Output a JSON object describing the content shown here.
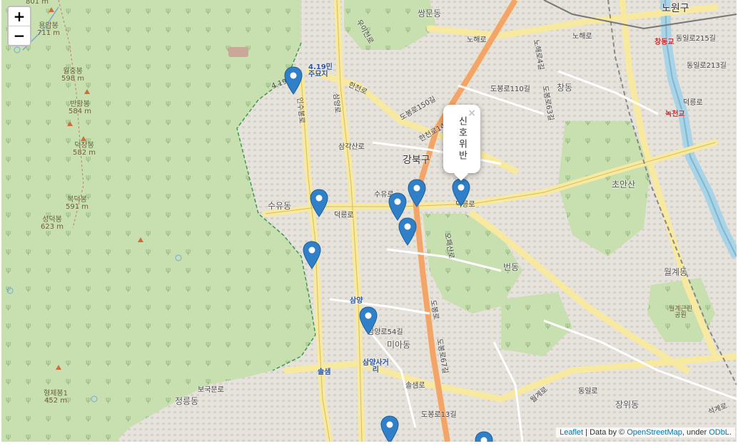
{
  "zoom": {
    "in_label": "+",
    "out_label": "−"
  },
  "popup": {
    "text": "신호위반",
    "close": "×"
  },
  "attribution": {
    "leaflet": "Leaflet",
    "sep": " | Data by © ",
    "osm": "OpenStreetMap",
    "under": ", under ",
    "odbl": "ODbL",
    "end": "."
  },
  "labels": {
    "gangbuk": "강북구",
    "nowon": "노원구",
    "suyu": "수유동",
    "beon": "번동",
    "mia": "미아동",
    "jeongneung": "정릉동",
    "ssangmun": "쌍문동",
    "chang": "창동",
    "wolgye": "월계동",
    "jangwi": "장위동",
    "chonan": "초안산",
    "wolgye_park": "월계근린\n공원",
    "p801": "801 m",
    "yongam": "용암봉\n711 m",
    "woljung": "월중봉\n598 m",
    "banhwang": "반황봉\n584 m",
    "deokjang": "덕장봉\n582 m",
    "bokdeok": "복덕봉\n591 m",
    "seongdeok": "성덕봉\n623 m",
    "hyeongje": "형제봉1\n452 m",
    "s419": "4.19민\n주묘지",
    "samyang": "삼양",
    "samyang_cross": "삼양사거\n리",
    "solsaem": "솔샘",
    "changdong_br": "창동교",
    "nokcheon": "녹천교",
    "r_nohae1": "노해로",
    "r_nohae2": "노해로",
    "r_dobong110": "도봉로110길",
    "r_dobong63": "도봉로63길",
    "r_uicheon": "우이천로",
    "r_samgak": "삼각산로",
    "r_deokneung": "덕릉로",
    "r_deokneung2": "덕릉로",
    "r_suyu": "수유로",
    "r_dobong": "도봉로",
    "r_hancheon": "한천로",
    "r_odaesan": "오패산로",
    "r_insu": "인수봉로",
    "r_samyang": "삼양로",
    "r_songjung": "솔샘로",
    "r_samyang54": "삼양로54길",
    "r_dobong67": "도봉로67길",
    "r_bokuk": "보국문로",
    "r_dobong13": "도봉로13길",
    "r_wolgye": "월계로",
    "r_dongil": "동일로",
    "r_seokgye": "석계로",
    "r_419": "4.19로",
    "r_dobong1": "도봉로150길",
    "r_hancheon144": "한천로144길",
    "r_deokneung_b": "덕릉로",
    "r_dongil215": "동일로215길",
    "r_dongil213": "동일로213길",
    "r_nohae4": "노해로4길"
  }
}
